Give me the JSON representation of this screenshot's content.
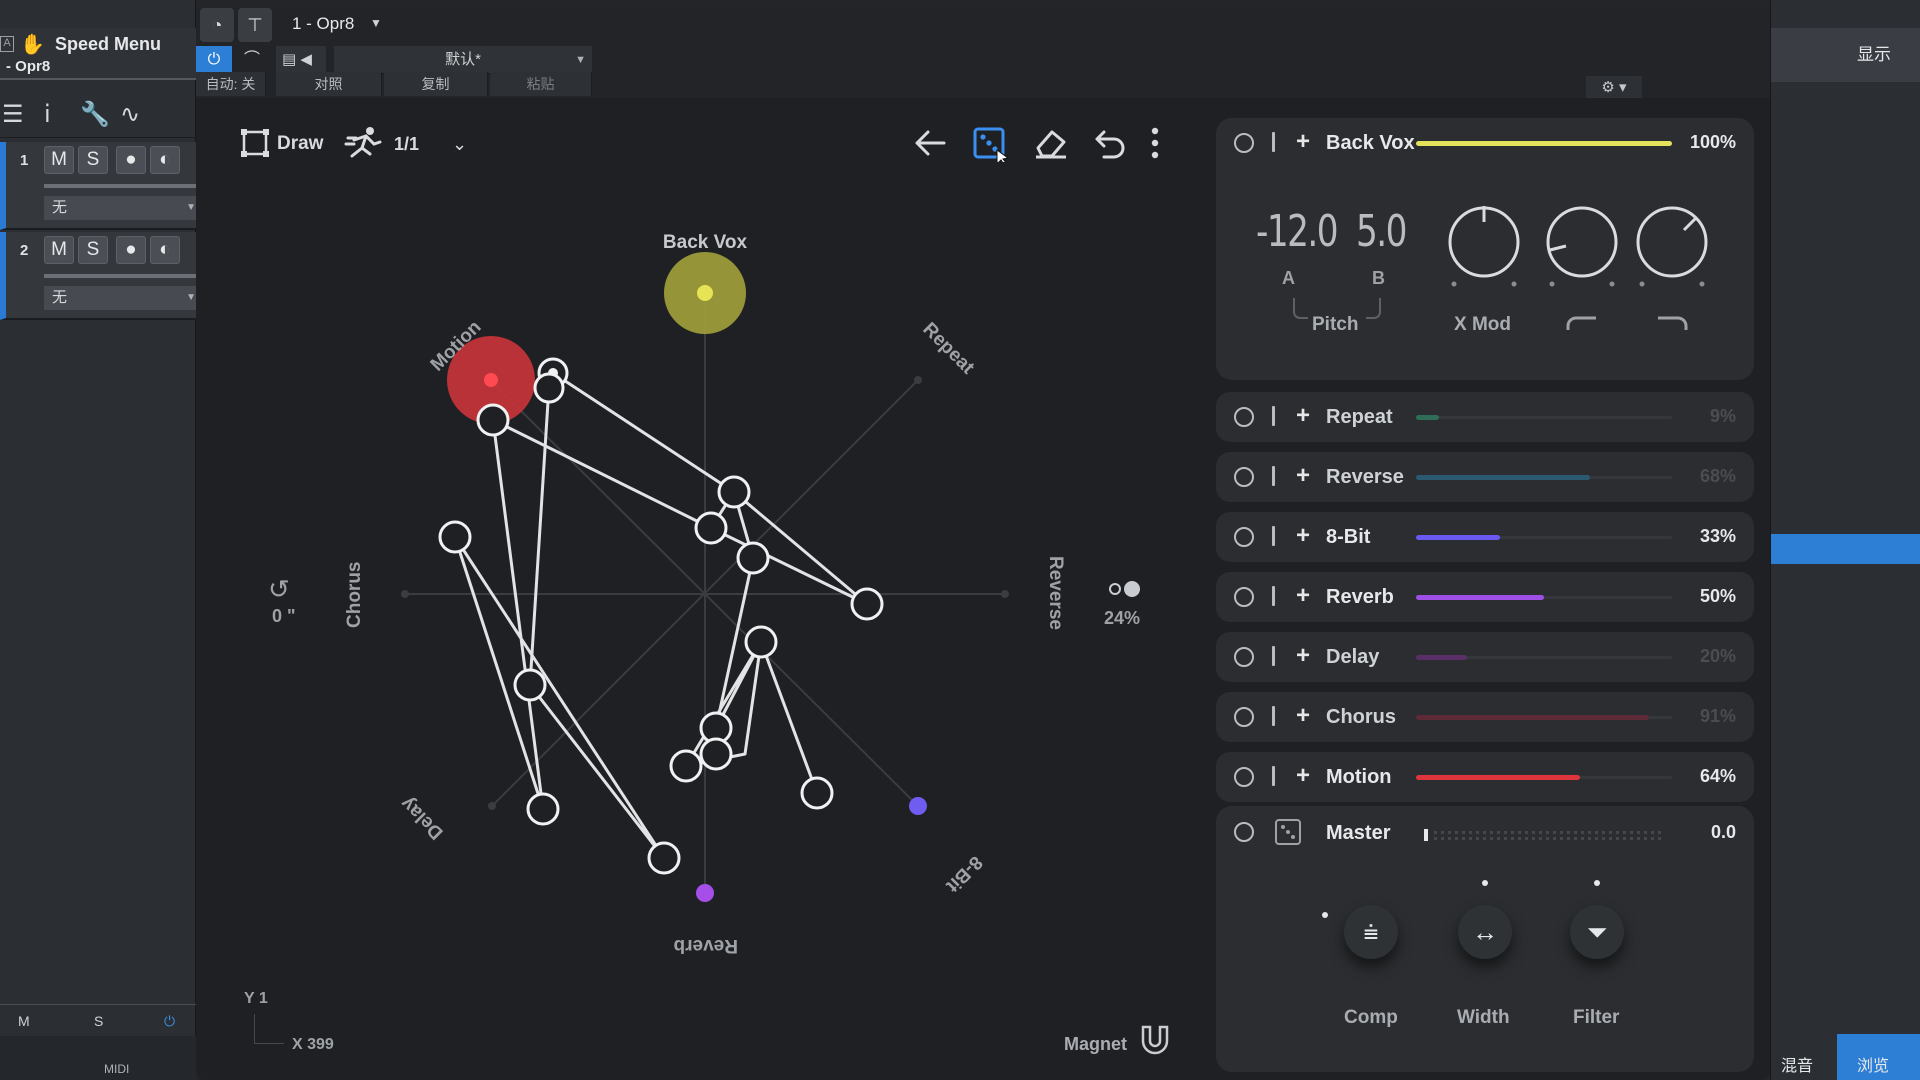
{
  "host": {
    "track_title": "Speed Menu",
    "track_sub": "- Opr8",
    "tracks": [
      {
        "num": "1",
        "m": "M",
        "s": "S",
        "select": "无"
      },
      {
        "num": "2",
        "m": "M",
        "s": "S",
        "select": "无"
      }
    ],
    "bottom": {
      "m": "M",
      "s": "S",
      "midi": "MIDI"
    },
    "right": {
      "show": "显示",
      "tab_mix": "混音",
      "tab_browse": "浏览"
    }
  },
  "plugin_header": {
    "tab": "1 - Opr8",
    "preset": "默认*",
    "auto": "自动: 关",
    "compare": "对照",
    "copy": "复制",
    "paste": "粘贴"
  },
  "toolbar": {
    "draw_label": "Draw",
    "rate_label": "1/1"
  },
  "xy": {
    "labels": {
      "back_vox": "Back Vox",
      "repeat": "Repeat",
      "reverse": "Reverse",
      "bit8": "8-Bit",
      "reverb": "Reverb",
      "delay": "Delay",
      "chorus": "Chorus",
      "motion": "Motion"
    },
    "rotation_value": "0 \"",
    "spread_value": "24%",
    "y_readout": "Y 1",
    "x_readout": "X 399",
    "magnet_label": "Magnet",
    "colors": {
      "back_vox": "#c9c84a",
      "motion": "#c9343a",
      "bit8": "#6f5cf0",
      "reverb": "#a54fe8"
    }
  },
  "modules": {
    "main": {
      "name": "Back Vox",
      "value": "100%",
      "level": 1.0,
      "color": "#e4e15a",
      "pitch_a": "-12.0",
      "pitch_b": "5.0",
      "a_label": "A",
      "b_label": "B",
      "pitch_label": "Pitch",
      "xmod_label": "X Mod"
    },
    "rows": [
      {
        "name": "Repeat",
        "value": "9%",
        "level": 0.09,
        "color": "#2f6e56",
        "dim": true
      },
      {
        "name": "Reverse",
        "value": "68%",
        "level": 0.68,
        "color": "#2b5a70",
        "dim": true
      },
      {
        "name": "8-Bit",
        "value": "33%",
        "level": 0.33,
        "color": "#6a59f0",
        "dim": false
      },
      {
        "name": "Reverb",
        "value": "50%",
        "level": 0.5,
        "color": "#a04fe6",
        "dim": false
      },
      {
        "name": "Delay",
        "value": "20%",
        "level": 0.2,
        "color": "#5a2f68",
        "dim": true
      },
      {
        "name": "Chorus",
        "value": "91%",
        "level": 0.91,
        "color": "#5e2a38",
        "dim": true
      },
      {
        "name": "Motion",
        "value": "64%",
        "level": 0.64,
        "color": "#e0343c",
        "dim": false
      }
    ],
    "master": {
      "name": "Master",
      "value": "0.0",
      "comp": "Comp",
      "width": "Width",
      "filter": "Filter"
    }
  }
}
